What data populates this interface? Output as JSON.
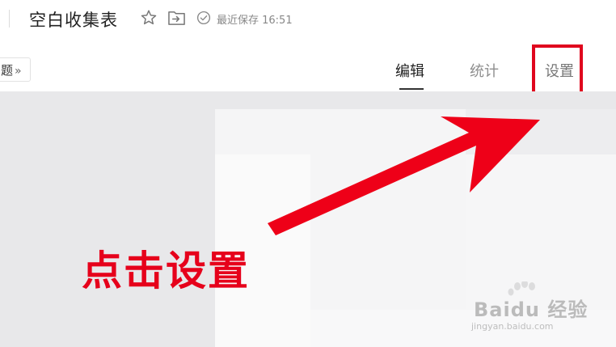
{
  "header": {
    "title": "空白收集表",
    "save_status": "最近保存 16:51"
  },
  "tabs": {
    "question_chip": "题",
    "chip_chevron": "»",
    "items": [
      {
        "label": "编辑",
        "active": true
      },
      {
        "label": "统计",
        "active": false
      },
      {
        "label": "设置",
        "active": false
      }
    ]
  },
  "annotation": {
    "text": "点击设置",
    "color": "#e6001b"
  },
  "watermark": {
    "brand": "Baidu 经验",
    "url": "jingyan.baidu.com"
  },
  "icons": {
    "favorite": "star-icon",
    "move": "folder-move-icon",
    "saved": "check-circle-icon"
  },
  "colors": {
    "highlight": "#e0061e",
    "canvas_bg": "#e8e8ea"
  }
}
